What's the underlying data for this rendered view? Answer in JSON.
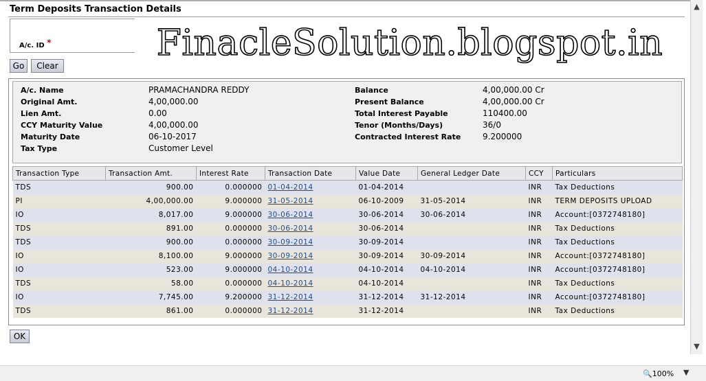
{
  "page": {
    "title": "Term Deposits Transaction Details"
  },
  "form": {
    "acid_label": "A/c. ID",
    "required_mark": "*",
    "go_label": "Go",
    "clear_label": "Clear",
    "ok_label": "OK"
  },
  "watermark": "FinacleSolution.blogspot.in",
  "summary": {
    "left": [
      {
        "label": "A/c. Name",
        "value": "PRAMACHANDRA REDDY"
      },
      {
        "label": "Original Amt.",
        "value": "4,00,000.00"
      },
      {
        "label": "Lien Amt.",
        "value": "0.00"
      },
      {
        "label": "CCY Maturity Value",
        "value": "4,00,000.00"
      },
      {
        "label": "Maturity Date",
        "value": "06-10-2017"
      },
      {
        "label": "Tax Type",
        "value": "Customer Level"
      }
    ],
    "right": [
      {
        "label": "Balance",
        "value": "4,00,000.00 Cr"
      },
      {
        "label": "Present Balance",
        "value": "4,00,000.00 Cr"
      },
      {
        "label": "Total Interest Payable",
        "value": "110400.00"
      },
      {
        "label": "Tenor (Months/Days)",
        "value": "36/0"
      },
      {
        "label": "Contracted Interest Rate",
        "value": "9.200000"
      }
    ]
  },
  "table": {
    "headers": [
      "Transaction Type",
      "Transaction Amt.",
      "Interest Rate",
      "Transaction Date",
      "Value Date",
      "General Ledger Date",
      "CCY",
      "Particulars"
    ],
    "rows": [
      [
        "TDS",
        "900.00",
        "0.000000",
        "01-04-2014",
        "01-04-2014",
        "",
        "INR",
        "Tax Deductions"
      ],
      [
        "PI",
        "4,00,000.00",
        "9.000000",
        "31-05-2014",
        "06-10-2009",
        "31-05-2014",
        "INR",
        "TERM DEPOSITS UPLOAD"
      ],
      [
        "IO",
        "8,017.00",
        "9.000000",
        "30-06-2014",
        "30-06-2014",
        "30-06-2014",
        "INR",
        "Account:[0372748180]"
      ],
      [
        "TDS",
        "891.00",
        "0.000000",
        "30-06-2014",
        "30-06-2014",
        "",
        "INR",
        "Tax Deductions"
      ],
      [
        "TDS",
        "900.00",
        "0.000000",
        "30-09-2014",
        "30-09-2014",
        "",
        "INR",
        "Tax Deductions"
      ],
      [
        "IO",
        "8,100.00",
        "9.000000",
        "30-09-2014",
        "30-09-2014",
        "30-09-2014",
        "INR",
        "Account:[0372748180]"
      ],
      [
        "IO",
        "523.00",
        "9.000000",
        "04-10-2014",
        "04-10-2014",
        "04-10-2014",
        "INR",
        "Account:[0372748180]"
      ],
      [
        "TDS",
        "58.00",
        "0.000000",
        "04-10-2014",
        "04-10-2014",
        "",
        "INR",
        "Tax Deductions"
      ],
      [
        "IO",
        "7,745.00",
        "9.200000",
        "31-12-2014",
        "31-12-2014",
        "31-12-2014",
        "INR",
        "Account:[0372748180]"
      ],
      [
        "TDS",
        "861.00",
        "0.000000",
        "31-12-2014",
        "31-12-2014",
        "",
        "INR",
        "Tax Deductions"
      ]
    ]
  },
  "statusbar": {
    "zoom": "100%"
  },
  "icons": {
    "zoom": "magnifier-icon",
    "dropdown": "chevron-down-icon",
    "scroll_up": "scroll-up-icon",
    "scroll_down": "scroll-down-icon"
  },
  "colors": {
    "link": "#1b4f8f",
    "required": "#d40000",
    "row_odd": "#dfe2ec",
    "row_even": "#e9e5da"
  }
}
